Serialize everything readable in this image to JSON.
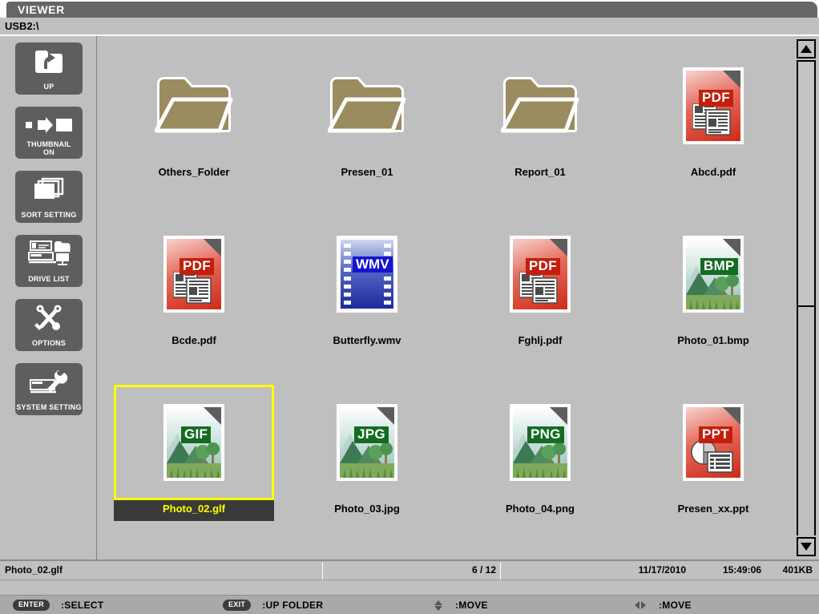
{
  "window": {
    "title": "VIEWER",
    "path": "USB2:\\"
  },
  "colors": {
    "titlebar_bg": "#666666",
    "body_bg": "#bfbfbf",
    "sidebar_button_bg": "#5e5e5e",
    "selection_border": "#ffff00",
    "selection_label_bg": "#3a3a3a",
    "selection_label_text": "#ffff00",
    "folder": "#9a8c5f",
    "pdf_red": "#c21f0d",
    "image_green": "#156b22",
    "video_blue": "#1515cf"
  },
  "sidebar": {
    "items": [
      {
        "label": "UP",
        "icon": "folder-up-icon",
        "lines": 1
      },
      {
        "label": "THUMBNAIL\nON",
        "icon": "thumbnail-toggle-icon",
        "lines": 2
      },
      {
        "label": "SORT SETTING",
        "icon": "stacked-pages-icon",
        "lines": 1
      },
      {
        "label": "DRIVE LIST",
        "icon": "drive-list-icon",
        "lines": 1
      },
      {
        "label": "OPTIONS",
        "icon": "tools-icon",
        "lines": 1
      },
      {
        "label": "SYSTEM SETTING",
        "icon": "system-setting-icon",
        "lines": 1
      }
    ]
  },
  "files": [
    {
      "name": "Others_Folder",
      "kind": "folder",
      "badge": "",
      "selected": false
    },
    {
      "name": "Presen_01",
      "kind": "folder",
      "badge": "",
      "selected": false
    },
    {
      "name": "Report_01",
      "kind": "folder",
      "badge": "",
      "selected": false
    },
    {
      "name": "Abcd.pdf",
      "kind": "pdf",
      "badge": "PDF",
      "selected": false
    },
    {
      "name": "Bcde.pdf",
      "kind": "pdf",
      "badge": "PDF",
      "selected": false
    },
    {
      "name": "Butterfly.wmv",
      "kind": "video",
      "badge": "WMV",
      "selected": false
    },
    {
      "name": "Fghlj.pdf",
      "kind": "pdf",
      "badge": "PDF",
      "selected": false
    },
    {
      "name": "Photo_01.bmp",
      "kind": "image",
      "badge": "BMP",
      "selected": false
    },
    {
      "name": "Photo_02.glf",
      "kind": "image",
      "badge": "GIF",
      "selected": true
    },
    {
      "name": "Photo_03.jpg",
      "kind": "image",
      "badge": "JPG",
      "selected": false
    },
    {
      "name": "Photo_04.png",
      "kind": "image",
      "badge": "PNG",
      "selected": false
    },
    {
      "name": "Presen_xx.ppt",
      "kind": "ppt",
      "badge": "PPT",
      "selected": false
    }
  ],
  "scrollbar": {
    "up_arrow": "triangle-up-icon",
    "down_arrow": "triangle-down-icon",
    "thumb_top_pct": 0,
    "thumb_height_pct": 52
  },
  "status": {
    "filename": "Photo_02.glf",
    "counter": "6 / 12",
    "date": "11/17/2010",
    "time": "15:49:06",
    "size": "401KB"
  },
  "help": [
    {
      "key": "ENTER",
      "icon": "",
      "label": ":SELECT"
    },
    {
      "key": "EXIT",
      "icon": "",
      "label": ":UP FOLDER"
    },
    {
      "key": "",
      "icon": "updown-arrow-icon",
      "label": ":MOVE"
    },
    {
      "key": "",
      "icon": "leftright-arrow-icon",
      "label": ":MOVE"
    }
  ]
}
